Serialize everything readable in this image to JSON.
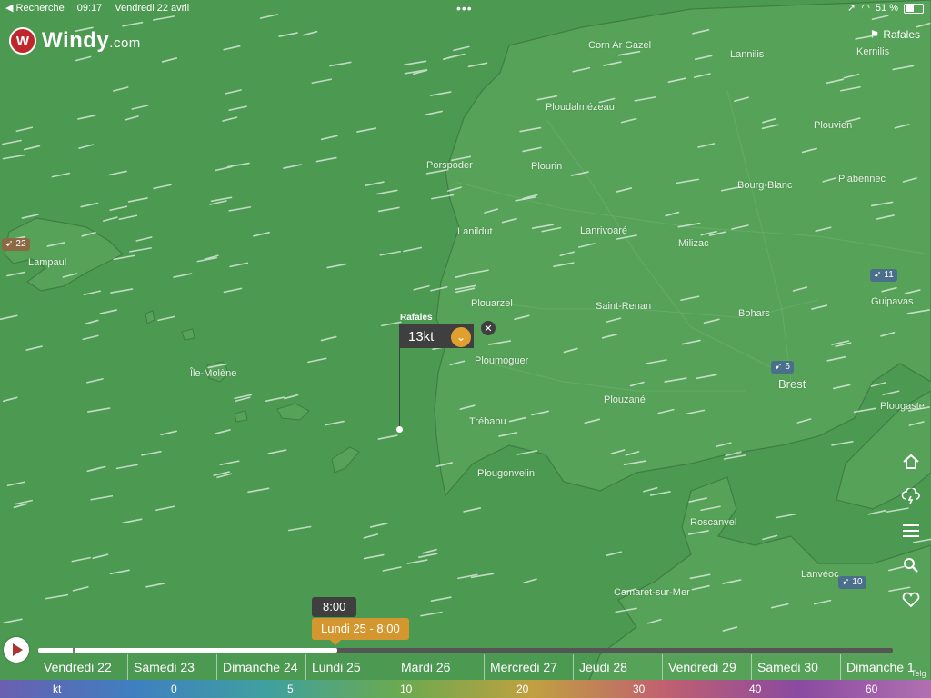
{
  "status_bar": {
    "back_label": "◀ Recherche",
    "time": "09:17",
    "date": "Vendredi 22 avril",
    "battery": "51 %"
  },
  "logo": {
    "name": "Windy",
    "suffix": ".com"
  },
  "layer": {
    "label": "Rafales"
  },
  "places": [
    {
      "id": "corn-ar-gazel",
      "name": "Corn Ar Gazel"
    },
    {
      "id": "lannilis",
      "name": "Lannilis"
    },
    {
      "id": "kernilis",
      "name": "Kernilis"
    },
    {
      "id": "ploudalmezeau",
      "name": "Ploudalmézeau"
    },
    {
      "id": "plouvien",
      "name": "Plouvien"
    },
    {
      "id": "porspoder",
      "name": "Porspoder"
    },
    {
      "id": "plourin",
      "name": "Plourin"
    },
    {
      "id": "bourg-blanc",
      "name": "Bourg-Blanc"
    },
    {
      "id": "plabennec",
      "name": "Plabennec"
    },
    {
      "id": "lanildut",
      "name": "Lanildut"
    },
    {
      "id": "lanrivoare",
      "name": "Lanrivoaré"
    },
    {
      "id": "milizac",
      "name": "Milizac"
    },
    {
      "id": "lampaul",
      "name": "Lampaul"
    },
    {
      "id": "plouarzel",
      "name": "Plouarzel"
    },
    {
      "id": "saint-renan",
      "name": "Saint-Renan"
    },
    {
      "id": "bohars",
      "name": "Bohars"
    },
    {
      "id": "guipavas",
      "name": "Guipavas"
    },
    {
      "id": "ile-molene",
      "name": "Île-Molène"
    },
    {
      "id": "ploumoguer",
      "name": "Ploumoguer"
    },
    {
      "id": "brest",
      "name": "Brest"
    },
    {
      "id": "plouzane",
      "name": "Plouzané"
    },
    {
      "id": "plougastel",
      "name": "Plougaste"
    },
    {
      "id": "trebabu",
      "name": "Trébabu"
    },
    {
      "id": "plougonvelin",
      "name": "Plougonvelin"
    },
    {
      "id": "roscanvel",
      "name": "Roscanvel"
    },
    {
      "id": "lanveoc",
      "name": "Lanvéoc"
    },
    {
      "id": "camaret",
      "name": "Camaret-sur-Mer"
    },
    {
      "id": "telg",
      "name": "Telg"
    }
  ],
  "stations": [
    {
      "id": "station-lampaul",
      "value": "22"
    },
    {
      "id": "station-guipavas",
      "value": "11"
    },
    {
      "id": "station-brest",
      "value": "6"
    },
    {
      "id": "station-lanveoc",
      "value": "10"
    }
  ],
  "picker": {
    "label": "Rafales",
    "value": "13kt",
    "dropdown_icon": "chevron-down-icon",
    "close_icon": "close-icon"
  },
  "tools": [
    "home-icon",
    "cloud-lightning-icon",
    "menu-icon",
    "search-icon",
    "heart-icon"
  ],
  "timeline": {
    "time_label": "8:00",
    "date_label": "Lundi 25 - 8:00",
    "progress_percent": 35,
    "days": [
      "Vendredi 22",
      "Samedi 23",
      "Dimanche 24",
      "Lundi 25",
      "Mardi 26",
      "Mercredi 27",
      "Jeudi 28",
      "Vendredi 29",
      "Samedi 30",
      "Dimanche 1"
    ]
  },
  "scale": {
    "unit": "kt",
    "ticks": [
      "0",
      "5",
      "10",
      "20",
      "30",
      "40",
      "60"
    ],
    "colors": [
      "#6a5fb0",
      "#3f7fc0",
      "#3fa0a0",
      "#6aaa50",
      "#c0a040",
      "#c06070",
      "#8a4aa0",
      "#b070b0"
    ]
  },
  "colors": {
    "sea": "#4c9a52",
    "land": "#56a259",
    "accent": "#d4972f",
    "brand": "#c0272d"
  }
}
